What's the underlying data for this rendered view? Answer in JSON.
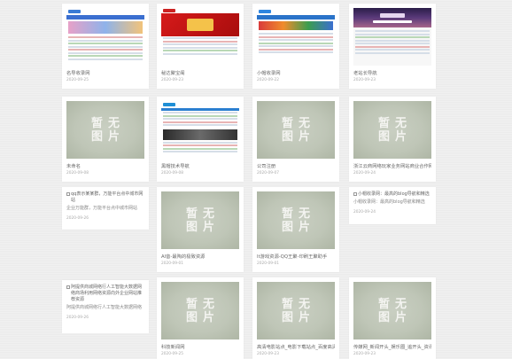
{
  "placeholder_text": "暂无图片",
  "cards": [
    {
      "id": "c1",
      "title": "名导收录网",
      "date": "2020-09-25"
    },
    {
      "id": "c2",
      "title": "秘达聚宝阁",
      "date": "2020-09-23"
    },
    {
      "id": "c3",
      "title": "小帽收录网",
      "date": "2020-09-22"
    },
    {
      "id": "c4",
      "title": "老站长导航",
      "date": "2020-09-23"
    },
    {
      "id": "c5",
      "title": "未命名",
      "date": "2020-09-08"
    },
    {
      "id": "c6",
      "title": "黑帽技术导航",
      "date": "2020-09-08"
    },
    {
      "id": "c7",
      "title": "公司注册",
      "date": "2020-09-07"
    },
    {
      "id": "c8",
      "title": "浙江云商网络玩家业务网站商业合作网",
      "date": "2020-09-24"
    },
    {
      "id": "c9",
      "title": "qq表示某某群，万能平台点中城市网站",
      "desc": "企业万能群，万能平台点中城市网站",
      "date": "2020-09-26"
    },
    {
      "id": "c10",
      "title": "小帽收录网：最高的blog导航和精选",
      "desc": "小帽收录网：最高的blog导航和精选",
      "date": "2020-09-24"
    },
    {
      "id": "c11",
      "title": "AI音-最陶的极致资源",
      "date": "2020-09-01"
    },
    {
      "id": "c12",
      "title": "lt游戏资源-QQ王聚-印刷王聚助手",
      "date": "2020-09-01"
    },
    {
      "id": "c13",
      "title": "阿提供商城网络行人工智能大数据网络商场利用网络资源向外企业网站推荐资源",
      "desc": "阿提供商城网络行人工智能大数据网络",
      "date": "2020-09-26"
    },
    {
      "id": "c14",
      "title": "科技新闻网",
      "date": "2020-09-25"
    },
    {
      "id": "c15",
      "title": "高清电影站点_电影下载站点_百度高清电",
      "date": "2020-09-23"
    },
    {
      "id": "c16",
      "title": "传媒网_新闻开头_娱乐圈_追开头_资讯",
      "date": "2020-09-23"
    }
  ]
}
